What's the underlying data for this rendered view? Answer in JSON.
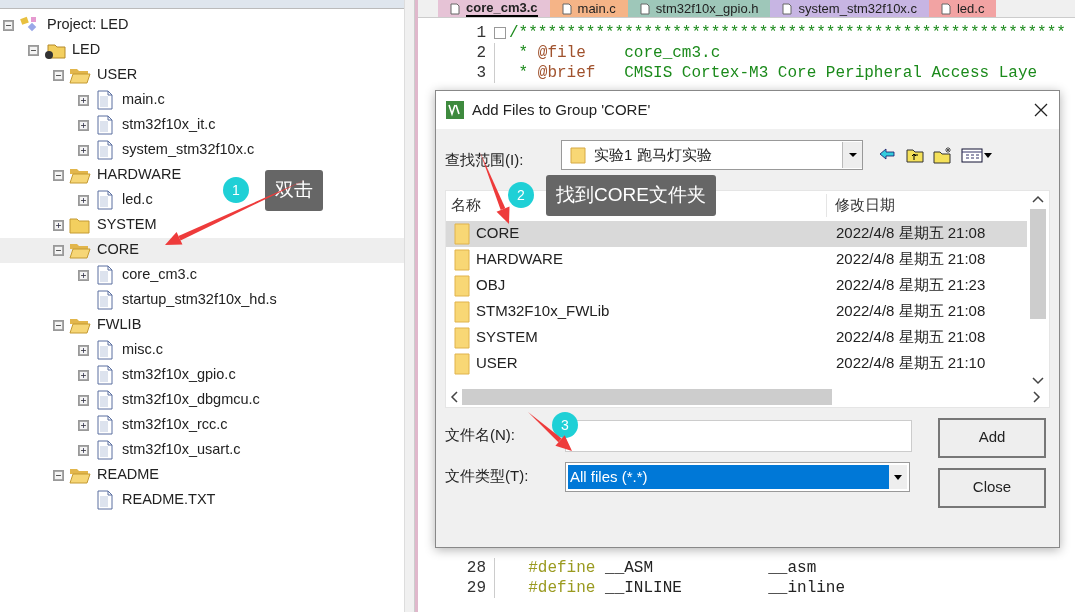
{
  "editor_tabs": [
    {
      "label": "core_cm3.c",
      "color": "#e6c3d6",
      "selected": true
    },
    {
      "label": "main.c",
      "color": "#f5b487",
      "selected": false
    },
    {
      "label": "stm32f10x_gpio.h",
      "color": "#9ec7b9",
      "selected": false
    },
    {
      "label": "system_stm32f10x.c",
      "color": "#c7b5e3",
      "selected": false
    },
    {
      "label": "led.c",
      "color": "#f2a3a3",
      "selected": false
    }
  ],
  "project_tree": [
    {
      "label": "Project: LED",
      "kind": "project",
      "expanded": true,
      "selected": false,
      "children": [
        {
          "label": "LED",
          "kind": "target",
          "expanded": true,
          "selected": false,
          "children": [
            {
              "label": "USER",
              "kind": "group",
              "expanded": true,
              "selected": false,
              "children": [
                {
                  "label": "main.c",
                  "kind": "file",
                  "expanded": false,
                  "selected": false
                },
                {
                  "label": "stm32f10x_it.c",
                  "kind": "file",
                  "expanded": false,
                  "selected": false
                },
                {
                  "label": "system_stm32f10x.c",
                  "kind": "file",
                  "expanded": false,
                  "selected": false
                }
              ]
            },
            {
              "label": "HARDWARE",
              "kind": "group",
              "expanded": true,
              "selected": false,
              "children": [
                {
                  "label": "led.c",
                  "kind": "file",
                  "expanded": false,
                  "selected": false
                }
              ]
            },
            {
              "label": "SYSTEM",
              "kind": "group",
              "expanded": false,
              "selected": false
            },
            {
              "label": "CORE",
              "kind": "group",
              "expanded": true,
              "selected": true,
              "children": [
                {
                  "label": "core_cm3.c",
                  "kind": "file",
                  "expanded": false,
                  "selected": false
                },
                {
                  "label": "startup_stm32f10x_hd.s",
                  "kind": "file",
                  "selected": false
                }
              ]
            },
            {
              "label": "FWLIB",
              "kind": "group",
              "expanded": true,
              "selected": false,
              "children": [
                {
                  "label": "misc.c",
                  "kind": "file",
                  "expanded": false,
                  "selected": false
                },
                {
                  "label": "stm32f10x_gpio.c",
                  "kind": "file",
                  "expanded": false,
                  "selected": false
                },
                {
                  "label": "stm32f10x_dbgmcu.c",
                  "kind": "file",
                  "expanded": false,
                  "selected": false
                },
                {
                  "label": "stm32f10x_rcc.c",
                  "kind": "file",
                  "expanded": false,
                  "selected": false
                },
                {
                  "label": "stm32f10x_usart.c",
                  "kind": "file",
                  "expanded": false,
                  "selected": false
                }
              ]
            },
            {
              "label": "README",
              "kind": "group",
              "expanded": true,
              "selected": false,
              "children": [
                {
                  "label": "README.TXT",
                  "kind": "file",
                  "selected": false
                }
              ]
            }
          ]
        }
      ]
    }
  ],
  "code_top": [
    {
      "number": "1",
      "kind": "comment",
      "text": "/*********************************************************"
    },
    {
      "number": "2",
      "kind": "doc",
      "prefix": "*",
      "tag": "@file",
      "text": "core_cm3.c"
    },
    {
      "number": "3",
      "kind": "doc",
      "prefix": "*",
      "tag": "@brief",
      "text": "CMSIS Cortex-M3 Core Peripheral Access Laye"
    }
  ],
  "code_bottom": [
    {
      "number": "28",
      "kind": "define",
      "directive": "#define",
      "name": "__ASM",
      "value": "__asm"
    },
    {
      "number": "29",
      "kind": "define",
      "directive": "#define",
      "name": "__INLINE",
      "value": "__inline"
    }
  ],
  "dialog": {
    "title": "Add Files to Group 'CORE'",
    "look_in_label": "查找范围(I):",
    "look_in_value": "实验1 跑马灯实验",
    "columns": [
      "名称",
      "修改日期"
    ],
    "items": [
      {
        "name": "CORE",
        "modified": "2022/4/8 星期五 21:08",
        "selected": true
      },
      {
        "name": "HARDWARE",
        "modified": "2022/4/8 星期五 21:08",
        "selected": false
      },
      {
        "name": "OBJ",
        "modified": "2022/4/8 星期五 21:23",
        "selected": false
      },
      {
        "name": "STM32F10x_FWLib",
        "modified": "2022/4/8 星期五 21:08",
        "selected": false
      },
      {
        "name": "SYSTEM",
        "modified": "2022/4/8 星期五 21:08",
        "selected": false
      },
      {
        "name": "USER",
        "modified": "2022/4/8 星期五 21:10",
        "selected": false
      }
    ],
    "file_name_label": "文件名(N):",
    "file_type_label": "文件类型(T):",
    "file_type_value": "All files (*.*)",
    "buttons": [
      "Add",
      "Close"
    ]
  },
  "annotations": [
    {
      "number": "1",
      "text": "双击"
    },
    {
      "number": "2",
      "text": "找到CORE文件夹"
    },
    {
      "number": "3"
    }
  ]
}
